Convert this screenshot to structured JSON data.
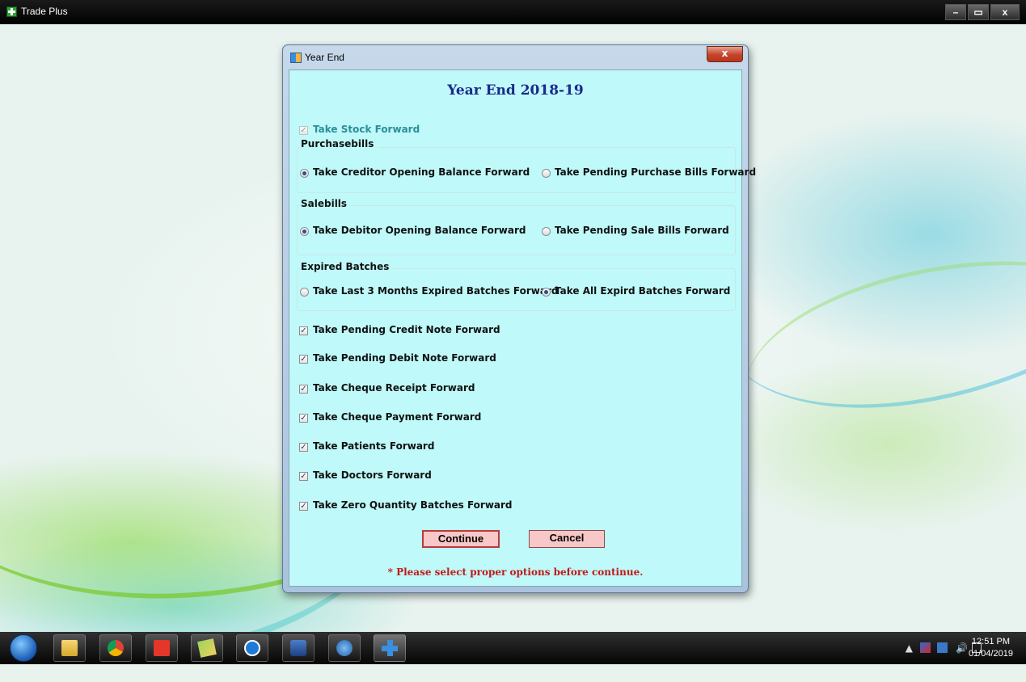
{
  "app": {
    "title": "Trade Plus",
    "minimize": "–",
    "restore": "▭",
    "close": "x"
  },
  "dialog": {
    "title": "Year End",
    "close": "x",
    "heading": "Year End 2018-19",
    "stock_forward": {
      "label": "Take Stock Forward",
      "checked": true,
      "enabled": false
    },
    "purchasebills": {
      "title": "Purchasebills",
      "options": [
        {
          "label": "Take Creditor Opening Balance Forward",
          "selected": true
        },
        {
          "label": "Take Pending Purchase Bills Forward",
          "selected": false
        }
      ]
    },
    "salebills": {
      "title": "Salebills",
      "options": [
        {
          "label": "Take Debitor Opening Balance Forward",
          "selected": true
        },
        {
          "label": "Take Pending Sale Bills Forward",
          "selected": false
        }
      ]
    },
    "expired_batches": {
      "title": "Expired Batches",
      "options": [
        {
          "label": "Take Last 3 Months Expired Batches Forward",
          "selected": false
        },
        {
          "label": "Take All Expird Batches Forward",
          "selected": true
        }
      ]
    },
    "checkboxes": [
      {
        "label": "Take Pending Credit Note Forward",
        "checked": true
      },
      {
        "label": "Take Pending Debit Note Forward",
        "checked": true
      },
      {
        "label": "Take Cheque Receipt Forward",
        "checked": true
      },
      {
        "label": "Take Cheque Payment Forward",
        "checked": true
      },
      {
        "label": "Take Patients Forward",
        "checked": true
      },
      {
        "label": "Take Doctors Forward",
        "checked": true
      },
      {
        "label": "Take Zero Quantity Batches Forward",
        "checked": true
      }
    ],
    "continue_label": "Continue",
    "cancel_label": "Cancel",
    "warning": "* Please select proper options before continue."
  },
  "taskbar": {
    "apps": [
      "explorer-icon",
      "chrome-icon",
      "anydesk-icon",
      "folder-app-icon",
      "teamviewer-icon",
      "network-app-icon",
      "thunderbird-icon",
      "trade-plus-icon"
    ],
    "tray": {
      "expand": "▲",
      "volume": "🔊"
    },
    "clock": {
      "time": "12:51 PM",
      "date": "01/04/2019"
    }
  },
  "colors": {
    "dialog_body": "#bff9f9",
    "heading": "#1b2a8c",
    "warning": "#c41818",
    "button_bg": "#f8c7c7"
  }
}
